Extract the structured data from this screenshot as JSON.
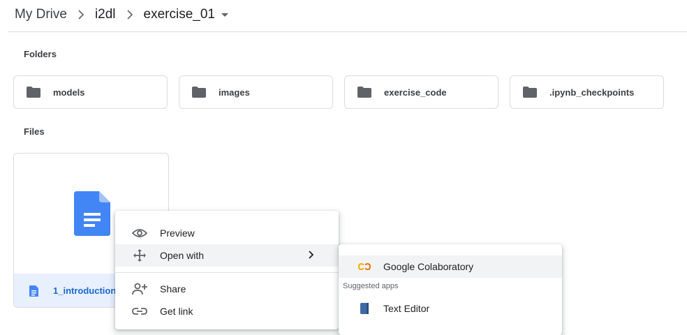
{
  "breadcrumb": {
    "items": [
      "My Drive",
      "i2dl",
      "exercise_01"
    ]
  },
  "sections": {
    "folders_label": "Folders",
    "files_label": "Files"
  },
  "folders": [
    {
      "name": "models"
    },
    {
      "name": "images"
    },
    {
      "name": "exercise_code"
    },
    {
      "name": ".ipynb_checkpoints"
    }
  ],
  "file": {
    "name": "1_introduction.ipynb",
    "visible_name": "1_introduction.i"
  },
  "context_menu": {
    "items": [
      "Preview",
      "Open with",
      "Share",
      "Get link"
    ]
  },
  "open_with_menu": {
    "primary": "Google Colaboratory",
    "suggested_heading": "Suggested apps",
    "suggested": [
      "Text Editor"
    ]
  },
  "colors": {
    "folder_icon": "#5f6368",
    "doc_blue": "#4285f4",
    "file_selected_bg": "#e8f0fe",
    "file_selected_text": "#1967d2",
    "colab_orange": "#f9ab00",
    "text_editor_blue": "#3f6aa1"
  },
  "icons": {
    "breadcrumb_separator": "chevron-right-icon",
    "breadcrumb_dropdown": "caret-down-icon",
    "folder": "folder-icon",
    "doc": "google-doc-icon",
    "preview": "eye-icon",
    "open_with": "move-arrows-icon",
    "share": "person-add-icon",
    "get_link": "link-icon",
    "submenu": "chevron-right-icon",
    "colab": "colab-icon",
    "text_editor": "text-editor-icon"
  }
}
